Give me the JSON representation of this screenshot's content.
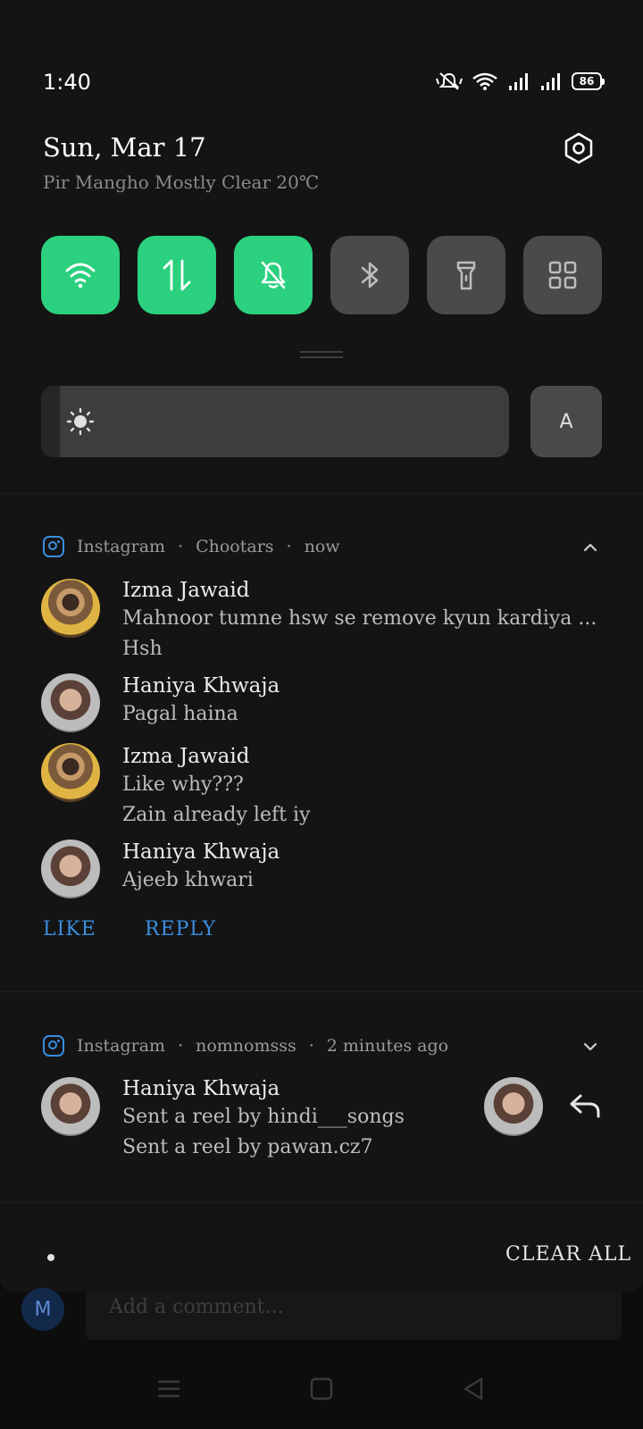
{
  "status_bar": {
    "time": "1:40",
    "battery": "86"
  },
  "header": {
    "date": "Sun, Mar 17",
    "weather": "Pir Mangho Mostly Clear 20℃"
  },
  "quick_tiles": [
    {
      "name": "wifi",
      "state": "on"
    },
    {
      "name": "mobile-data",
      "state": "on"
    },
    {
      "name": "mute",
      "state": "on"
    },
    {
      "name": "bluetooth",
      "state": "off"
    },
    {
      "name": "flashlight",
      "state": "off"
    },
    {
      "name": "more",
      "state": "off"
    }
  ],
  "brightness": {
    "level": 0.04,
    "auto_label": "A"
  },
  "notifications": [
    {
      "app": "Instagram",
      "source": "Chootars",
      "time": "now",
      "expanded": true,
      "messages": [
        {
          "sender": "Izma Jawaid",
          "lines": [
            "Mahnoor tumne hsw se remove kyun kardiya ...",
            "Hsh"
          ]
        },
        {
          "sender": "Haniya Khwaja",
          "lines": [
            "Pagal haina"
          ]
        },
        {
          "sender": "Izma Jawaid",
          "lines": [
            "Like why???",
            "Zain already left iy"
          ]
        },
        {
          "sender": "Haniya Khwaja",
          "lines": [
            "Ajeeb khwari"
          ]
        }
      ],
      "actions": [
        "LIKE",
        "REPLY"
      ]
    },
    {
      "app": "Instagram",
      "source": "nomnomsss",
      "time": "2 minutes ago",
      "expanded": false,
      "sender": "Haniya Khwaja",
      "lines": [
        "Sent a reel by hindi___songs",
        "Sent a reel by pawan.cz7"
      ]
    }
  ],
  "footer": {
    "clear_all": "CLEAR ALL"
  },
  "background": {
    "avatar_letter": "M",
    "comment_placeholder": "Add a comment..."
  },
  "colors": {
    "accent_green": "#2bd17e",
    "accent_blue": "#3a8dde",
    "shade_bg": "#141414"
  }
}
